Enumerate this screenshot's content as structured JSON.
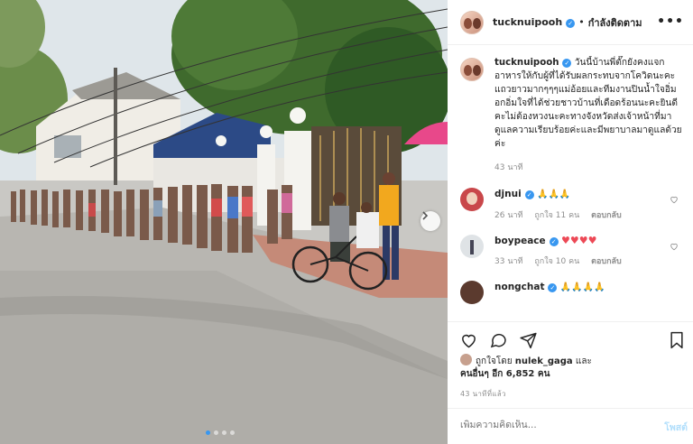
{
  "header": {
    "username": "tucknuipooh",
    "verified_mark": "✓",
    "separator": "•",
    "follow_label": "กำลังติดตาม",
    "more_label": "•••"
  },
  "caption": {
    "username": "tucknuipooh",
    "verified_mark": "✓",
    "text": "วันนี้บ้านพี่ตั๊กยังคงแจกอาหารให้กับผู้ที่ได้รับผลกระทบจากโควิดนะคะแถวยาวมากๆๆๆแม่อ้อยและทีมงานปินน้ำใจอิ่มอกอิ่มใจที่ได้ช่วยชาวบ้านที่เดือดร้อนนะคะยินดีคะไม่ต้องหวงนะคะทางจังหวัดส่งเจ้าหน้าที่มาดูแลความเรียบร้อยค่ะและมีพยาบาลมาดูแลด้วยค่ะ",
    "time": "43 นาที"
  },
  "comments": [
    {
      "username": "djnui",
      "verified_mark": "✓",
      "text": "🙏🙏🙏",
      "time": "26 นาที",
      "likes": "ถูกใจ 11 คน",
      "reply": "ตอบกลับ"
    },
    {
      "username": "boypeace",
      "verified_mark": "✓",
      "text": "♥♥♥♥",
      "time": "33 นาที",
      "likes": "ถูกใจ 10 คน",
      "reply": "ตอบกลับ"
    },
    {
      "username": "nongchat",
      "verified_mark": "✓",
      "text": "🙏🙏🙏🙏"
    }
  ],
  "likes": {
    "liked_by_prefix": "ถูกใจโดย",
    "liked_by_user": "nulek_gaga",
    "and": "และ",
    "others": "คนอื่นๆ อีก 6,852 คน"
  },
  "time_ago": "43 นาทีที่แล้ว",
  "comment_box": {
    "placeholder": "เพิ่มความคิดเห็น...",
    "post_label": "โพสต์"
  },
  "carousel": {
    "slide_count": 4,
    "active_slide": 1
  },
  "colors": {
    "accent": "#3897f0",
    "heart": "#ed4956",
    "muted": "#8e8e8e"
  }
}
